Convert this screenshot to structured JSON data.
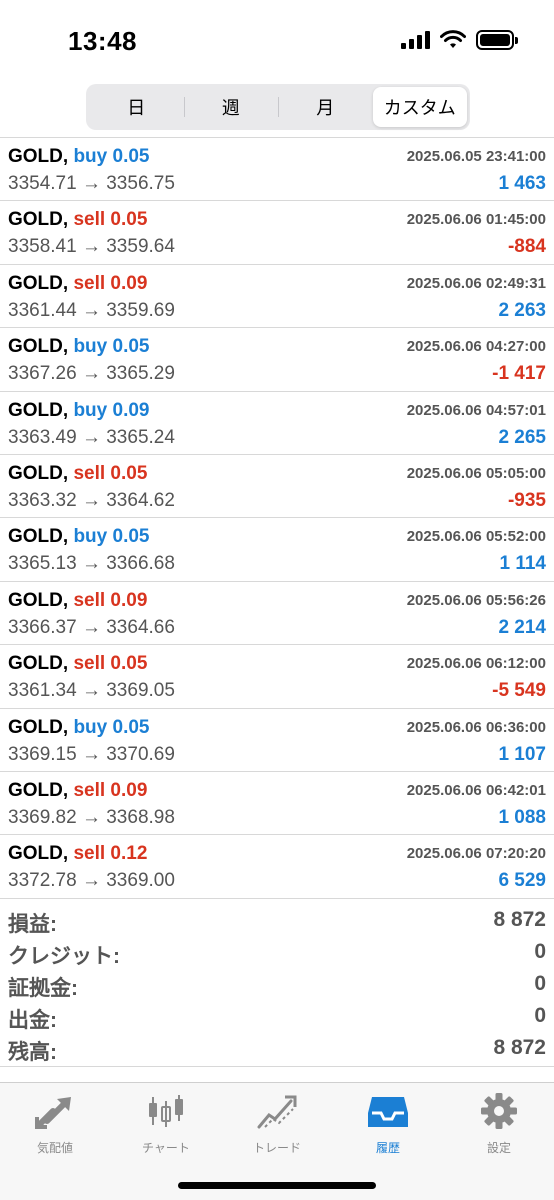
{
  "status": {
    "time": "13:48"
  },
  "segments": [
    {
      "label": "日",
      "active": false
    },
    {
      "label": "週",
      "active": false
    },
    {
      "label": "月",
      "active": false
    },
    {
      "label": "カスタム",
      "active": true
    }
  ],
  "trades": [
    {
      "symbol": "GOLD,",
      "side": "buy",
      "side_label": "buy 0.05",
      "time": "2025.06.05 23:41:00",
      "prices": "3354.71 → 3356.75",
      "profit": "1 463",
      "profit_sign": "pos"
    },
    {
      "symbol": "GOLD,",
      "side": "sell",
      "side_label": "sell 0.05",
      "time": "2025.06.06 01:45:00",
      "prices": "3358.41 → 3359.64",
      "profit": "-884",
      "profit_sign": "neg"
    },
    {
      "symbol": "GOLD,",
      "side": "sell",
      "side_label": "sell 0.09",
      "time": "2025.06.06 02:49:31",
      "prices": "3361.44 → 3359.69",
      "profit": "2 263",
      "profit_sign": "pos"
    },
    {
      "symbol": "GOLD,",
      "side": "buy",
      "side_label": "buy 0.05",
      "time": "2025.06.06 04:27:00",
      "prices": "3367.26 → 3365.29",
      "profit": "-1 417",
      "profit_sign": "neg"
    },
    {
      "symbol": "GOLD,",
      "side": "buy",
      "side_label": "buy 0.09",
      "time": "2025.06.06 04:57:01",
      "prices": "3363.49 → 3365.24",
      "profit": "2 265",
      "profit_sign": "pos"
    },
    {
      "symbol": "GOLD,",
      "side": "sell",
      "side_label": "sell 0.05",
      "time": "2025.06.06 05:05:00",
      "prices": "3363.32 → 3364.62",
      "profit": "-935",
      "profit_sign": "neg"
    },
    {
      "symbol": "GOLD,",
      "side": "buy",
      "side_label": "buy 0.05",
      "time": "2025.06.06 05:52:00",
      "prices": "3365.13 → 3366.68",
      "profit": "1 114",
      "profit_sign": "pos"
    },
    {
      "symbol": "GOLD,",
      "side": "sell",
      "side_label": "sell 0.09",
      "time": "2025.06.06 05:56:26",
      "prices": "3366.37 → 3364.66",
      "profit": "2 214",
      "profit_sign": "pos"
    },
    {
      "symbol": "GOLD,",
      "side": "sell",
      "side_label": "sell 0.05",
      "time": "2025.06.06 06:12:00",
      "prices": "3361.34 → 3369.05",
      "profit": "-5 549",
      "profit_sign": "neg"
    },
    {
      "symbol": "GOLD,",
      "side": "buy",
      "side_label": "buy 0.05",
      "time": "2025.06.06 06:36:00",
      "prices": "3369.15 → 3370.69",
      "profit": "1 107",
      "profit_sign": "pos"
    },
    {
      "symbol": "GOLD,",
      "side": "sell",
      "side_label": "sell 0.09",
      "time": "2025.06.06 06:42:01",
      "prices": "3369.82 → 3368.98",
      "profit": "1 088",
      "profit_sign": "pos"
    },
    {
      "symbol": "GOLD,",
      "side": "sell",
      "side_label": "sell 0.12",
      "time": "2025.06.06 07:20:20",
      "prices": "3372.78 → 3369.00",
      "profit": "6 529",
      "profit_sign": "pos"
    }
  ],
  "summary": [
    {
      "label": "損益:",
      "value": "8 872"
    },
    {
      "label": "クレジット:",
      "value": "0"
    },
    {
      "label": "証拠金:",
      "value": "0"
    },
    {
      "label": "出金:",
      "value": "0"
    },
    {
      "label": "残高:",
      "value": "8 872"
    }
  ],
  "tabs": [
    {
      "label": "気配値",
      "icon": "quotes-arrows-icon",
      "active": false
    },
    {
      "label": "チャート",
      "icon": "candlestick-chart-icon",
      "active": false
    },
    {
      "label": "トレード",
      "icon": "trade-chart-icon",
      "active": false
    },
    {
      "label": "履歴",
      "icon": "history-inbox-icon",
      "active": true
    },
    {
      "label": "設定",
      "icon": "gear-icon",
      "active": false
    }
  ],
  "colors": {
    "buy": "#1b7fd4",
    "sell": "#d8341f",
    "accent": "#1b7fd4",
    "inactive_tab": "#8a8a8a"
  }
}
